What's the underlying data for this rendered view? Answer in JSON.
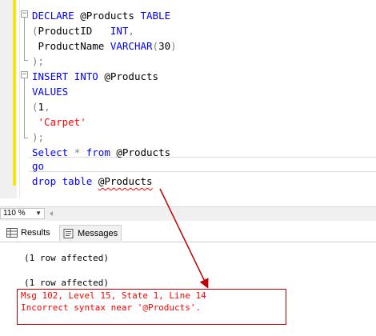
{
  "editor": {
    "lines": [
      [
        {
          "t": "DECLARE",
          "c": "kw"
        },
        {
          "t": " @Products ",
          "c": ""
        },
        {
          "t": "TABLE",
          "c": "kw"
        }
      ],
      [
        {
          "t": "(",
          "c": "gray"
        },
        {
          "t": "ProductID   ",
          "c": ""
        },
        {
          "t": "INT",
          "c": "kw"
        },
        {
          "t": ",",
          "c": "gray"
        }
      ],
      [
        {
          "t": " ProductName ",
          "c": ""
        },
        {
          "t": "VARCHAR",
          "c": "kw"
        },
        {
          "t": "(",
          "c": "gray"
        },
        {
          "t": "30",
          "c": ""
        },
        {
          "t": ")",
          "c": "gray"
        }
      ],
      [
        {
          "t": ");",
          "c": "gray"
        }
      ],
      [
        {
          "t": "INSERT INTO",
          "c": "kw"
        },
        {
          "t": " @Products",
          "c": ""
        }
      ],
      [
        {
          "t": "VALUES",
          "c": "kw"
        }
      ],
      [
        {
          "t": "(",
          "c": "gray"
        },
        {
          "t": "1",
          "c": ""
        },
        {
          "t": ",",
          "c": "gray"
        }
      ],
      [
        {
          "t": " 'Carpet'",
          "c": "str"
        }
      ],
      [
        {
          "t": ");",
          "c": "gray"
        }
      ],
      [
        {
          "t": "Select",
          "c": "kw"
        },
        {
          "t": " ",
          "c": ""
        },
        {
          "t": "*",
          "c": "gray"
        },
        {
          "t": " ",
          "c": ""
        },
        {
          "t": "from",
          "c": "kw"
        },
        {
          "t": " @Products",
          "c": ""
        }
      ],
      [
        {
          "t": "go",
          "c": "kw"
        }
      ],
      [
        {
          "t": "drop",
          "c": "kw"
        },
        {
          "t": " ",
          "c": ""
        },
        {
          "t": "table",
          "c": "kw"
        },
        {
          "t": " ",
          "c": ""
        },
        {
          "t": "@Products",
          "c": "",
          "squiggle": true
        }
      ]
    ]
  },
  "zoom": {
    "value": "110 %"
  },
  "tabs": {
    "results": "Results",
    "messages": "Messages"
  },
  "messages": {
    "line1": "(1 row affected)",
    "line2": "(1 row affected)",
    "error1": "Msg 102, Level 15, State 1, Line 14",
    "error2": "Incorrect syntax near '@Products'."
  },
  "colors": {
    "keyword": "#0000ff",
    "string": "#ff0000",
    "error": "#ff0000",
    "arrow": "#c00000"
  }
}
